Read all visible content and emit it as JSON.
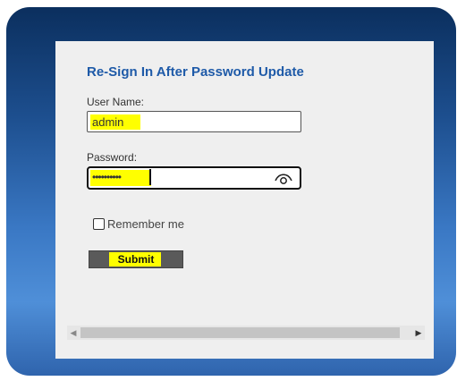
{
  "form": {
    "title": "Re-Sign In After Password Update",
    "username_label": "User Name:",
    "username_value": "admin",
    "password_label": "Password:",
    "password_masked": "••••••••••",
    "remember_label": "Remember me",
    "remember_checked": false,
    "submit_label": "Submit"
  },
  "icons": {
    "password_toggle": "eye-icon",
    "scroll_left": "chevron-left-icon",
    "scroll_right": "chevron-right-icon"
  },
  "colors": {
    "title": "#1e5aa8",
    "highlight": "#ffff00",
    "frame_top": "#0b2f5e",
    "frame_bottom": "#4f8fd8"
  }
}
